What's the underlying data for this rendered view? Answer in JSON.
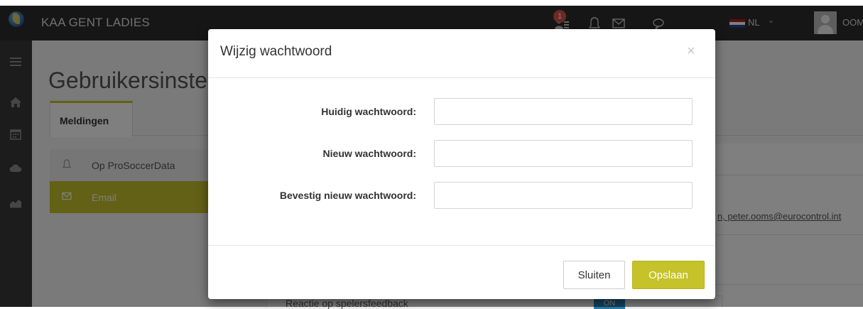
{
  "topbar": {
    "team_name": "KAA GENT LADIES",
    "notification_count": "1",
    "language": "NL",
    "user_name": "OOMS A",
    "icons": [
      "logo",
      "bell-icon",
      "envelope-icon",
      "chat-icon",
      "user-list-icon",
      "netherlands-flag-icon",
      "chevron-down-icon",
      "avatar"
    ]
  },
  "sidebar": {
    "icons": [
      "menu-icon",
      "home-icon",
      "calendar-icon",
      "cloud-icon",
      "chart-icon"
    ]
  },
  "page": {
    "title": "Gebruikersinstellingen",
    "tab_label": "Meldingen",
    "menu": [
      {
        "label": "Op ProSoccerData",
        "icon": "bell-icon"
      },
      {
        "label": "Email",
        "icon": "envelope-icon"
      }
    ],
    "email_addresses": "n, peter.ooms@eurocontrol.int",
    "row_label": "Reactie op spelersfeedback",
    "row_toggle": "ON"
  },
  "modal": {
    "title": "Wijzig wachtwoord",
    "close_symbol": "×",
    "fields": [
      {
        "label": "Huidig wachtwoord:",
        "value": "",
        "placeholder": ""
      },
      {
        "label": "Nieuw wachtwoord:",
        "value": "",
        "placeholder": ""
      },
      {
        "label": "Bevestig nieuw wachtwoord:",
        "value": "",
        "placeholder": ""
      }
    ],
    "close_button": "Sluiten",
    "save_button": "Opslaan"
  },
  "colors": {
    "accent": "#c5c22a",
    "topbar": "#2c2c2c",
    "sidebar": "#393939",
    "badge": "#d9534f",
    "toggle_on": "#2b84b6"
  }
}
